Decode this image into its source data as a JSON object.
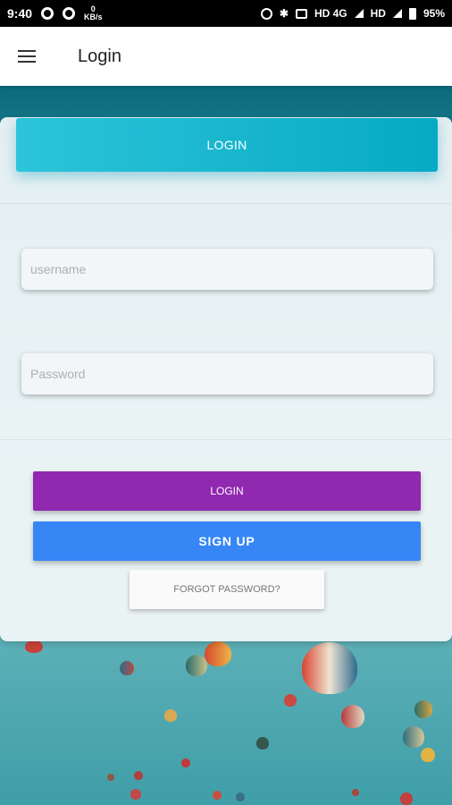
{
  "status_bar": {
    "time": "9:40",
    "kbs_value": "0",
    "kbs_unit": "KB/s",
    "network": "HD 4G",
    "hd": "HD",
    "battery": "95%"
  },
  "app_bar": {
    "title": "Login",
    "menu_icon": "hamburger-icon"
  },
  "card": {
    "header_label": "LOGIN",
    "username": {
      "value": "",
      "placeholder": "username"
    },
    "password": {
      "value": "",
      "placeholder": "Password"
    },
    "login_button": "LOGIN",
    "signup_button": "SIGN UP",
    "forgot_button": "FORGOT PASSWORD?"
  },
  "colors": {
    "header": "#1ebfd6",
    "login_button": "#9028b0",
    "signup_button": "#3686f5"
  }
}
